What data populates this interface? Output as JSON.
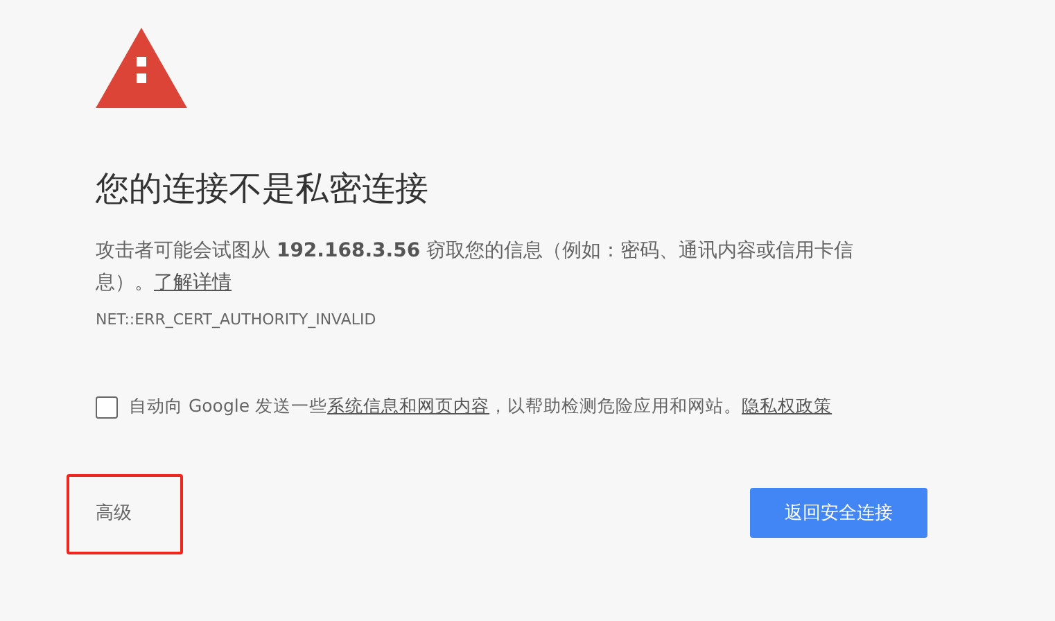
{
  "heading": "您的连接不是私密连接",
  "description": {
    "before": "攻击者可能会试图从 ",
    "host": "192.168.3.56",
    "after": " 窃取您的信息（例如：密码、通讯内容或信用卡信息）。",
    "link": "了解详情"
  },
  "error_code": "NET::ERR_CERT_AUTHORITY_INVALID",
  "report": {
    "checked": false,
    "before": "自动向 Google 发送一些",
    "link": "系统信息和网页内容",
    "after": "，以帮助检测危险应用和网站。",
    "policy_link": "隐私权政策"
  },
  "advanced_button": {
    "label": "高级",
    "highlighted": true
  },
  "back_button": {
    "label": "返回安全连接"
  }
}
